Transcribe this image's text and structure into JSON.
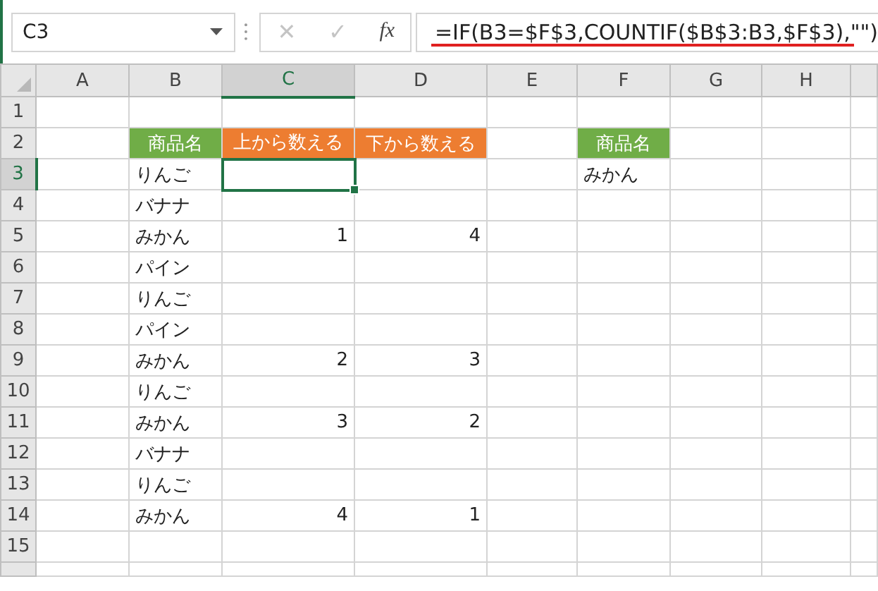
{
  "name_box": {
    "value": "C3"
  },
  "formula_buttons": [
    {
      "label": "✕",
      "disabled": true
    },
    {
      "label": "✓",
      "disabled": true
    },
    {
      "label": "fx",
      "disabled": false
    }
  ],
  "formula_bar": {
    "value": "=IF(B3=$F$3,COUNTIF($B$3:B3,$F$3),\"\")"
  },
  "columns": [
    {
      "label": "A",
      "selected": false
    },
    {
      "label": "B",
      "selected": false
    },
    {
      "label": "C",
      "selected": true
    },
    {
      "label": "D",
      "selected": false
    },
    {
      "label": "E",
      "selected": false
    },
    {
      "label": "F",
      "selected": false
    },
    {
      "label": "G",
      "selected": false
    },
    {
      "label": "H",
      "selected": false
    }
  ],
  "rows": [
    {
      "label": "1",
      "selected": false,
      "cells": []
    },
    {
      "label": "2",
      "selected": false,
      "cells": [
        {
          "kind": "empty",
          "selected": false
        },
        {
          "kind": "header",
          "text": "商品名",
          "color": "#70ad47",
          "selected": false
        },
        {
          "kind": "header",
          "text": "上から数える",
          "color": "#ed7d31",
          "selected": false
        },
        {
          "kind": "header",
          "text": "下から数える",
          "color": "#ed7d31",
          "selected": false
        },
        {
          "kind": "empty",
          "selected": false
        },
        {
          "kind": "header",
          "text": "商品名",
          "color": "#70ad47",
          "selected": false
        }
      ]
    },
    {
      "label": "3",
      "selected": true,
      "cells": [
        {
          "kind": "empty",
          "selected": false
        },
        {
          "kind": "text",
          "text": "りんご",
          "selected": false
        },
        {
          "kind": "empty",
          "selected": true
        },
        {
          "kind": "empty",
          "selected": false
        },
        {
          "kind": "empty",
          "selected": false
        },
        {
          "kind": "text",
          "text": "みかん",
          "selected": false
        }
      ]
    },
    {
      "label": "4",
      "selected": false,
      "cells": [
        {
          "kind": "empty",
          "selected": false
        },
        {
          "kind": "text",
          "text": "バナナ",
          "selected": false
        }
      ]
    },
    {
      "label": "5",
      "selected": false,
      "cells": [
        {
          "kind": "empty",
          "selected": false
        },
        {
          "kind": "text",
          "text": "みかん",
          "selected": false
        },
        {
          "kind": "number",
          "text": "1",
          "selected": false
        },
        {
          "kind": "number",
          "text": "4",
          "selected": false
        }
      ]
    },
    {
      "label": "6",
      "selected": false,
      "cells": [
        {
          "kind": "empty",
          "selected": false
        },
        {
          "kind": "text",
          "text": "パイン",
          "selected": false
        }
      ]
    },
    {
      "label": "7",
      "selected": false,
      "cells": [
        {
          "kind": "empty",
          "selected": false
        },
        {
          "kind": "text",
          "text": "りんご",
          "selected": false
        }
      ]
    },
    {
      "label": "8",
      "selected": false,
      "cells": [
        {
          "kind": "empty",
          "selected": false
        },
        {
          "kind": "text",
          "text": "パイン",
          "selected": false
        }
      ]
    },
    {
      "label": "9",
      "selected": false,
      "cells": [
        {
          "kind": "empty",
          "selected": false
        },
        {
          "kind": "text",
          "text": "みかん",
          "selected": false
        },
        {
          "kind": "number",
          "text": "2",
          "selected": false
        },
        {
          "kind": "number",
          "text": "3",
          "selected": false
        }
      ]
    },
    {
      "label": "10",
      "selected": false,
      "cells": [
        {
          "kind": "empty",
          "selected": false
        },
        {
          "kind": "text",
          "text": "りんご",
          "selected": false
        }
      ]
    },
    {
      "label": "11",
      "selected": false,
      "cells": [
        {
          "kind": "empty",
          "selected": false
        },
        {
          "kind": "text",
          "text": "みかん",
          "selected": false
        },
        {
          "kind": "number",
          "text": "3",
          "selected": false
        },
        {
          "kind": "number",
          "text": "2",
          "selected": false
        }
      ]
    },
    {
      "label": "12",
      "selected": false,
      "cells": [
        {
          "kind": "empty",
          "selected": false
        },
        {
          "kind": "text",
          "text": "バナナ",
          "selected": false
        }
      ]
    },
    {
      "label": "13",
      "selected": false,
      "cells": [
        {
          "kind": "empty",
          "selected": false
        },
        {
          "kind": "text",
          "text": "りんご",
          "selected": false
        }
      ]
    },
    {
      "label": "14",
      "selected": false,
      "cells": [
        {
          "kind": "empty",
          "selected": false
        },
        {
          "kind": "text",
          "text": "みかん",
          "selected": false
        },
        {
          "kind": "number",
          "text": "4",
          "selected": false
        },
        {
          "kind": "number",
          "text": "1",
          "selected": false
        }
      ]
    },
    {
      "label": "15",
      "selected": false,
      "cells": []
    }
  ]
}
